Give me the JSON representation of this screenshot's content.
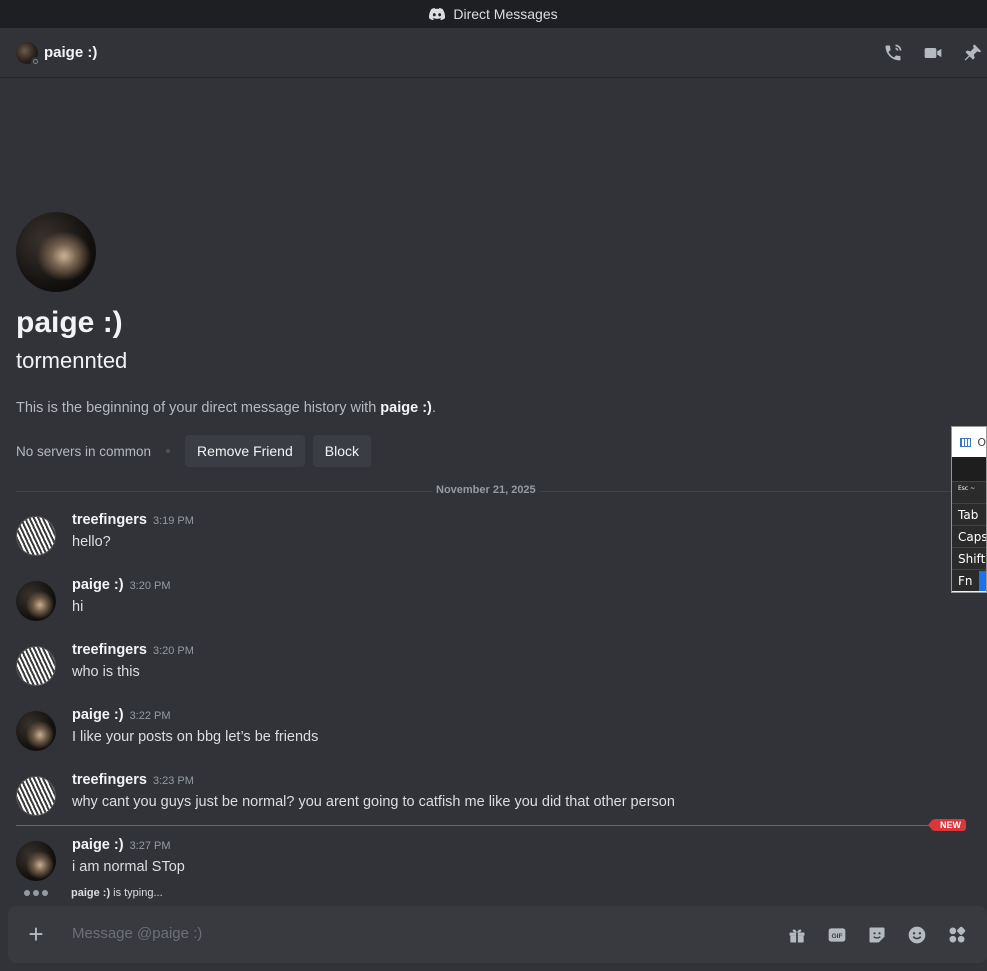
{
  "window": {
    "title": "Direct Messages"
  },
  "header": {
    "name": "paige :)"
  },
  "intro": {
    "display_name": "paige :)",
    "username": "tormennted",
    "description_prefix": "This is the beginning of your direct message history with ",
    "description_name": "paige :)",
    "description_suffix": ".",
    "mutual_servers": "No servers in common",
    "remove_friend_label": "Remove Friend",
    "block_label": "Block"
  },
  "date_divider": "November 21, 2025",
  "messages": [
    {
      "author": "treefingers",
      "time": "3:19 PM",
      "text": "hello?",
      "avatar": "treefingers-avatar"
    },
    {
      "author": "paige :)",
      "time": "3:20 PM",
      "text": "hi",
      "avatar": "paige-avatar"
    },
    {
      "author": "treefingers",
      "time": "3:20 PM",
      "text": "who is this",
      "avatar": "treefingers-avatar"
    },
    {
      "author": "paige :)",
      "time": "3:22 PM",
      "text": "I like your posts on bbg let’s be friends",
      "avatar": "paige-avatar"
    },
    {
      "author": "treefingers",
      "time": "3:23 PM",
      "text": "why cant you guys just be normal? you arent going to catfish me like you did that other person",
      "avatar": "treefingers-avatar"
    },
    {
      "author": "paige :)",
      "time": "3:27 PM",
      "text": "i am normal STop",
      "avatar": "paige-avatar"
    }
  ],
  "new_badge": "NEW",
  "typing": {
    "name": "paige :)",
    "suffix": "is typing..."
  },
  "composer": {
    "placeholder": "Message @paige :)"
  },
  "osk": {
    "title": "O",
    "keys": [
      "Esc  ~",
      "Tab",
      "Caps",
      "Shift",
      "Fn"
    ]
  },
  "colors": {
    "background": "#313338",
    "accent_red": "#da373c",
    "text": "#dbdee1"
  }
}
